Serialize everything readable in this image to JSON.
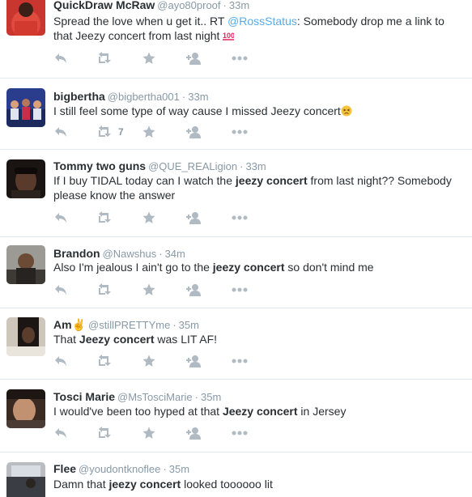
{
  "tweets": [
    {
      "name": "QuickDraw McRaw",
      "handle": "@ayo80proof",
      "sep": "·",
      "time": "33m",
      "text_a": "Spread the love when u get it.. RT ",
      "mention": "@RossStatus",
      "text_b": ": Somebody drop me a link to that Jeezy concert from last night ",
      "emoji": "100-emoji",
      "retweet_count": ""
    },
    {
      "name": "bigbertha",
      "handle": "@bigbertha001",
      "sep": "·",
      "time": "33m",
      "text_a": "I still feel some type of way cause I missed Jeezy concert",
      "emoji": "persevering-face-emoji",
      "retweet_count": "7"
    },
    {
      "name": "Tommy two guns",
      "handle": "@QUE_REALigion",
      "sep": "·",
      "time": "33m",
      "text_a": "If I buy TIDAL today can I watch the ",
      "bold": "jeezy concert",
      "text_b": " from last night?? Somebody please know the answer",
      "retweet_count": ""
    },
    {
      "name": "Brandon",
      "handle": "@Nawshus",
      "sep": "·",
      "time": "34m",
      "text_a": "Also I'm jealous I ain't go to the ",
      "bold": "jeezy concert",
      "text_b": " so don't mind me",
      "retweet_count": ""
    },
    {
      "name": "Am✌",
      "handle": "@stillPRETTYme",
      "sep": "·",
      "time": "35m",
      "text_a": "That ",
      "bold": "Jeezy concert",
      "text_b": " was LIT AF!",
      "retweet_count": ""
    },
    {
      "name": "Tosci Marie",
      "handle": "@MsTosciMarie",
      "sep": "·",
      "time": "35m",
      "text_a": "I would've been too hyped at that ",
      "bold": "Jeezy concert",
      "text_b": " in Jersey",
      "retweet_count": ""
    },
    {
      "name": "Flee",
      "handle": "@youdontknoflee",
      "sep": "·",
      "time": "35m",
      "text_a": "Damn that ",
      "bold": "jeezy concert",
      "text_b": " looked toooooo lit",
      "retweet_count": ""
    }
  ],
  "action_icons": [
    "reply-icon",
    "retweet-icon",
    "favorite-icon",
    "follow-icon",
    "more-icon"
  ],
  "colors": {
    "link": "#55acee",
    "muted": "#8899a6",
    "icon": "#b0bac3",
    "divider": "#e1e8ed",
    "text": "#292f33"
  }
}
